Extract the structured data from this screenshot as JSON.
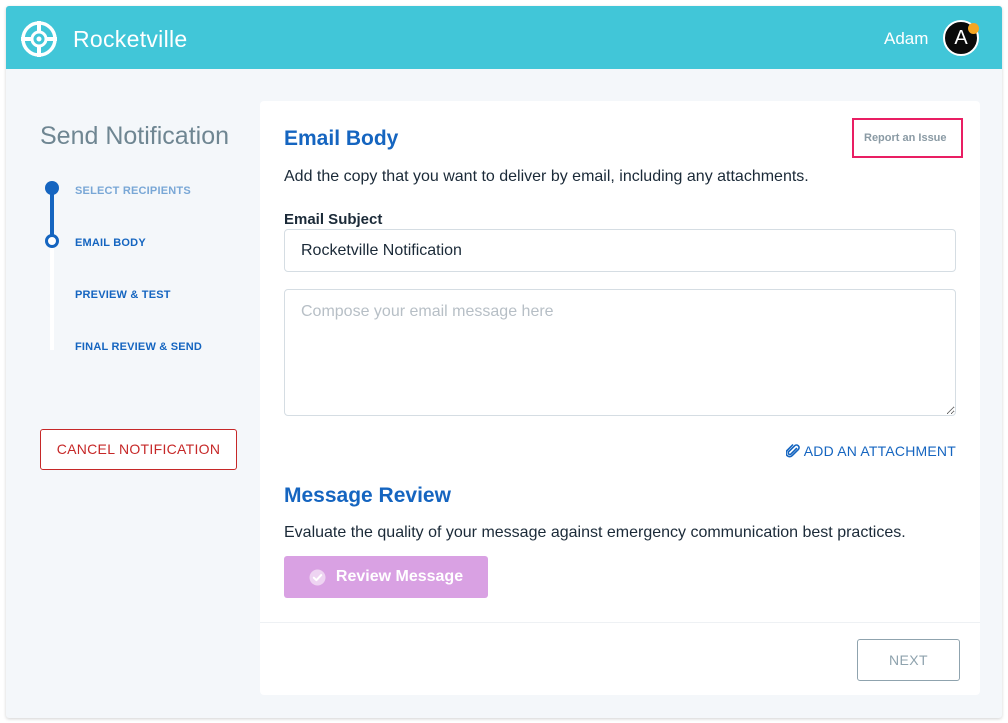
{
  "header": {
    "brand": "Rocketville",
    "user_name": "Adam",
    "avatar_initial": "A",
    "logo_icon": "rocketville-logo-icon",
    "notification_dot_color": "#f5a623"
  },
  "sidebar": {
    "title": "Send Notification",
    "steps": [
      {
        "label": "SELECT RECIPIENTS",
        "state": "completed"
      },
      {
        "label": "EMAIL BODY",
        "state": "current"
      },
      {
        "label": "PREVIEW & TEST",
        "state": "upcoming"
      },
      {
        "label": "FINAL REVIEW & SEND",
        "state": "upcoming"
      }
    ],
    "cancel_label": "CANCEL NOTIFICATION"
  },
  "email_body": {
    "title": "Email Body",
    "report_issue": "Report an Issue",
    "description": "Add the copy that you want to deliver by email, including any attachments.",
    "subject_label": "Email Subject",
    "subject_value": "Rocketville Notification",
    "body_placeholder": "Compose your email message here",
    "attachment_label": "ADD AN ATTACHMENT",
    "attachment_icon": "paperclip-icon"
  },
  "message_review": {
    "title": "Message Review",
    "description": "Evaluate the quality of your message against emergency communication best practices.",
    "button_label": "Review Message",
    "button_icon": "check-circle-icon"
  },
  "footer": {
    "next_label": "NEXT"
  },
  "colors": {
    "header": "#41c6d8",
    "primary": "#1565c0",
    "danger": "#c62828",
    "highlight": "#e91e63",
    "review_button": "#d9a1e3"
  }
}
